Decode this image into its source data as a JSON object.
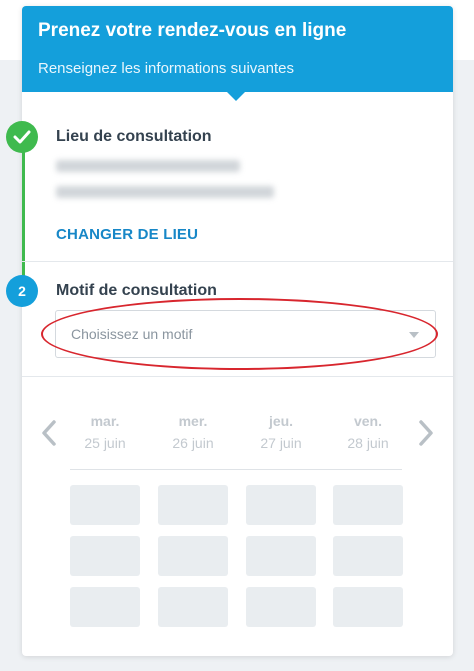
{
  "header": {
    "title": "Prenez votre rendez-vous en ligne",
    "subtitle": "Renseignez les informations suivantes"
  },
  "steps": [
    {
      "number": "✓",
      "title": "Lieu de consultation",
      "status": "completed",
      "color": "#3fba4e"
    },
    {
      "number": "2",
      "title": "Motif de consultation",
      "status": "active",
      "color": "#149fdb"
    }
  ],
  "location": {
    "change_label": "CHANGER DE LIEU"
  },
  "motif_select": {
    "placeholder": "Choisissez un motif"
  },
  "calendar": {
    "days": [
      {
        "name": "mar.",
        "date": "25 juin"
      },
      {
        "name": "mer.",
        "date": "26 juin"
      },
      {
        "name": "jeu.",
        "date": "27 juin"
      },
      {
        "name": "ven.",
        "date": "28 juin"
      }
    ]
  },
  "icons": {
    "prev": "chevron-left-icon",
    "next": "chevron-right-icon",
    "check": "check-icon",
    "dropdown": "chevron-down-icon"
  },
  "colors": {
    "primary": "#149fdb",
    "success": "#3fba4e",
    "link": "#1787c7",
    "annotation": "#d8262e"
  }
}
